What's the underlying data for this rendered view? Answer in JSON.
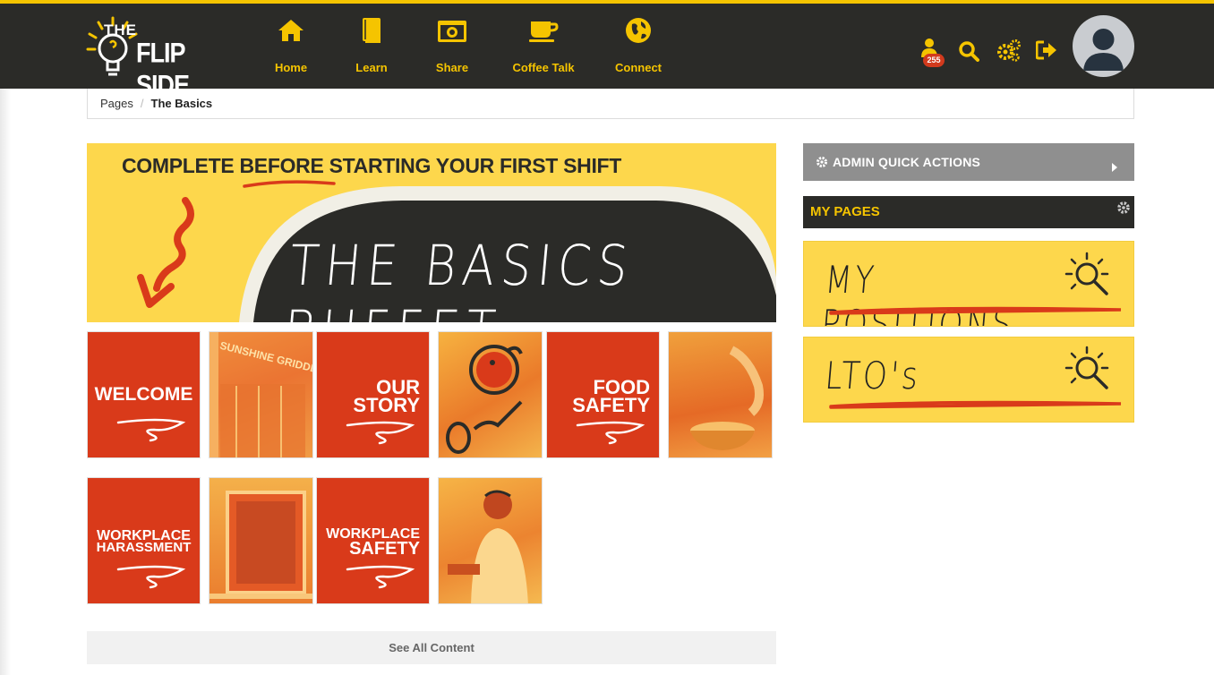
{
  "header": {
    "logo": {
      "the": "THE",
      "name": "FLIP SIDE"
    },
    "nav": [
      {
        "label": "Home",
        "icon": "home-icon"
      },
      {
        "label": "Learn",
        "icon": "book-icon"
      },
      {
        "label": "Share",
        "icon": "camera-icon"
      },
      {
        "label": "Coffee Talk",
        "icon": "coffee-cup-icon"
      },
      {
        "label": "Connect",
        "icon": "globe-icon"
      }
    ],
    "notifications": {
      "count": "255",
      "icon": "user-icon"
    },
    "icons": [
      "search-icon",
      "gears-icon",
      "sign-out-icon"
    ],
    "accent": "#f5c400",
    "bar_color": "#2b2b28"
  },
  "breadcrumb": {
    "root": "Pages",
    "separator": "/",
    "current": "The Basics"
  },
  "banner": {
    "subtitle": "COMPLETE BEFORE STARTING YOUR FIRST SHIFT",
    "title": "THE BASICS BUFFET"
  },
  "tiles": [
    {
      "line1": "WELCOME",
      "line2": ""
    },
    {
      "line1": "OUR",
      "line2": "STORY"
    },
    {
      "line1": "FOOD",
      "line2": "SAFETY"
    },
    {
      "line1": "WORKPLACE",
      "line2": "HARASSMENT"
    },
    {
      "line1": "WORKPLACE",
      "line2": "SAFETY"
    }
  ],
  "photo_sign": "SUNSHINE GRIDDLE",
  "see_all": "See All Content",
  "sidebar": {
    "admin_quick_actions": "ADMIN QUICK ACTIONS",
    "my_pages": "MY PAGES",
    "cards": [
      {
        "label": "MY POSITIONS"
      },
      {
        "label": "LTO's"
      }
    ]
  },
  "colors": {
    "red": "#d93a1a",
    "yellow": "#fdd74c",
    "dark": "#2b2b28"
  }
}
